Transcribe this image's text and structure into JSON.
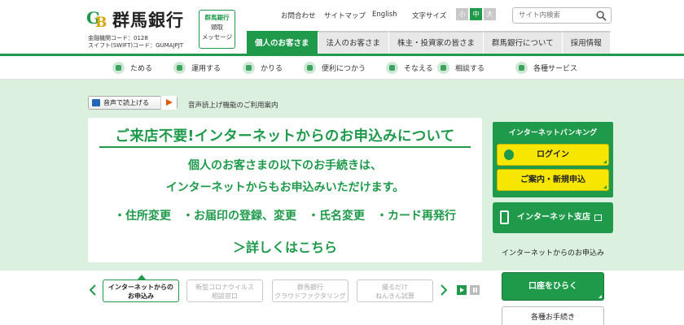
{
  "header": {
    "logo_text": "群馬銀行",
    "logo_mark": "GB",
    "bank_code": "金融機関コード：0128",
    "swift_code": "スイフト(SWIFT)コード：GUMAJPJT",
    "message_box": {
      "line1": "群馬銀行",
      "line2": "頭取",
      "line3": "メッセージ"
    },
    "util_links": [
      "お問合わせ",
      "サイトマップ",
      "English"
    ],
    "font_size_label": "文字サイズ",
    "font_sizes": [
      "小",
      "中",
      "大"
    ],
    "font_size_active": "中",
    "search_placeholder": "サイト内検索",
    "main_tabs": [
      "個人のお客さま",
      "法人のお客さま",
      "株主・投資家の皆さま",
      "群馬銀行について",
      "採用情報"
    ],
    "main_tab_active": "個人のお客さま"
  },
  "subnav": {
    "items": [
      "ためる",
      "運用する",
      "かりる",
      "便利につかう",
      "そなえる",
      "相談する",
      "各種サービス"
    ]
  },
  "voice": {
    "button_label": "音声で読上げる",
    "guide_link": "音声読上げ機能のご利用案内"
  },
  "banner": {
    "title": "ご来店不要!インターネットからのお申込みについて",
    "body_line1": "個人のお客さまの以下のお手続きは、",
    "body_line2": "インターネットからもお申込みいただけます。",
    "items": "・住所変更　・お届印の登録、変更　・氏名変更　・カード再発行",
    "more": "＞詳しくはこちら"
  },
  "carousel": {
    "tabs": [
      {
        "line1": "インターネットからの",
        "line2": "お申込み"
      },
      {
        "line1": "新型コロナウイルス",
        "line2": "相談窓口"
      },
      {
        "line1": "群馬銀行",
        "line2": "クラウドファクタリング"
      },
      {
        "line1": "撮るだけ",
        "line2": "ねんきん試算"
      }
    ],
    "active_index": 0
  },
  "sidebar": {
    "ib_title": "インターネットバンキング",
    "login_label": "ログイン",
    "guide_label": "ご案内・新規申込",
    "branch_label": "インターネット支店",
    "apply_label": "インターネットからのお申込み",
    "open_account_label": "口座をひらく",
    "procedures_label": "各種お手続き"
  },
  "colors": {
    "brand_green": "#1e9a4a",
    "accent_yellow": "#f6e600",
    "band_bg": "#dcf0df"
  }
}
